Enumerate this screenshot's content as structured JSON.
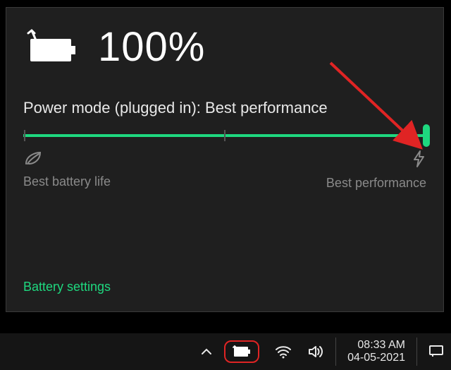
{
  "battery": {
    "percent": "100%",
    "mode_label": "Power mode (plugged in): Best performance",
    "slider": {
      "left_label": "Best battery life",
      "right_label": "Best performance"
    },
    "settings_link": "Battery settings"
  },
  "taskbar": {
    "time": "08:33 AM",
    "date": "04-05-2021"
  },
  "colors": {
    "accent": "#1ed87f",
    "annotation": "#e02424"
  }
}
